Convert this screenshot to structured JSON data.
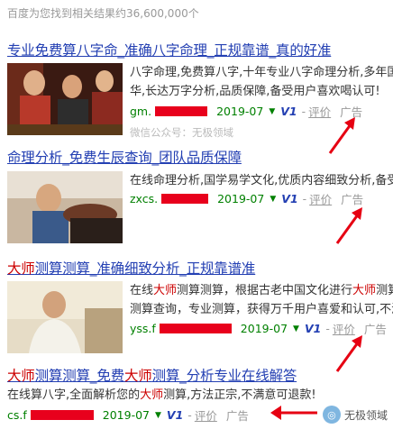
{
  "summary": "百度为您找到相关结果约36,600,000个",
  "results": [
    {
      "title": "专业免费算八字命_准确八字命理_正规靠谱_真的好准",
      "snippet_lines": [
        "八字命理,免费算八字,十年专业八字命理分析,多年国",
        "华,长达万字分析,品质保障,备受用户喜欢喝认可!"
      ],
      "domain": "gm.",
      "date": "2019-07",
      "vlabel": "V1",
      "review": "评价",
      "ad": "广告",
      "wechat": "微信公众号：无极领域"
    },
    {
      "title": "命理分析_免费生辰查询_团队品质保障",
      "snippet_lines": [
        "在线命理分析,国学易学文化,优质内容细致分析,备受"
      ],
      "domain": "zxcs.",
      "date": "2019-07",
      "vlabel": "V1",
      "review": "评价",
      "ad": "广告"
    },
    {
      "title_hl1": "大师",
      "title_rest": "测算测算_准确细致分析_正规靠谱准",
      "snippet_line1_a": "在线",
      "snippet_line1_hl": "大师",
      "snippet_line1_b": "测算测算，根据古老中国文化进行",
      "snippet_line1_hl2": "大师",
      "snippet_line1_c": "测算",
      "snippet_line2": "测算查询，专业测算，获得万千用户喜爱和认可,不满",
      "domain": "yss.f",
      "date": "2019-07",
      "vlabel": "V1",
      "review": "评价",
      "ad": "广告"
    },
    {
      "title_hl1": "大师",
      "title_mid": "测算测算_免费",
      "title_hl2": "大师",
      "title_rest": "测算_分析专业在线解答",
      "snippet_a": "在线算八字,全面解析您的",
      "snippet_hl": "大师",
      "snippet_b": "测算,方法正宗,不满意可退款!",
      "domain": "cs.f",
      "date": "2019-07",
      "vlabel": "V1",
      "review": "评价",
      "ad": "广告"
    }
  ],
  "watermark": "无极领域",
  "colors": {
    "link": "#2440b3",
    "green": "#008000",
    "highlight": "#cc0000",
    "arrow": "#e60012"
  }
}
